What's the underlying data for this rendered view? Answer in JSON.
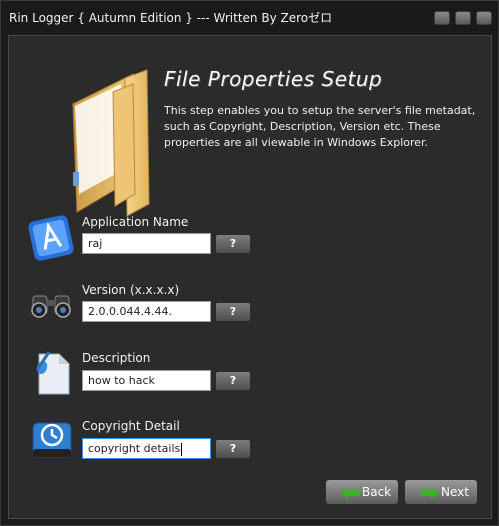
{
  "window": {
    "title": "Rin Logger  { Autumn Edition } --- Written By Zeroゼロ"
  },
  "header": {
    "title": "File Properties Setup",
    "description": "This step enables you to setup the server's file metadat, such as Copyright, Description, Version etc. These properties are all viewable in Windows Explorer."
  },
  "fields": [
    {
      "label": "Application Name",
      "value": "raj",
      "help": "?",
      "icon": "app-store-icon"
    },
    {
      "label": "Version (x.x.x.x)",
      "value": "2.0.0.044.4.44.",
      "help": "?",
      "icon": "binoculars-icon"
    },
    {
      "label": "Description",
      "value": "how to hack",
      "help": "?",
      "icon": "document-icon"
    },
    {
      "label": "Copyright Detail",
      "value": "copyright details",
      "help": "?",
      "icon": "time-machine-drive-icon"
    }
  ],
  "nav": {
    "back_label": "Back",
    "next_label": "Next"
  },
  "colors": {
    "background": "#1b1b1b",
    "panel": "#2b2b2b",
    "button": "#6e6e6e",
    "arrow_green": "#3fae2a",
    "input_focus": "#3d8fd8"
  }
}
